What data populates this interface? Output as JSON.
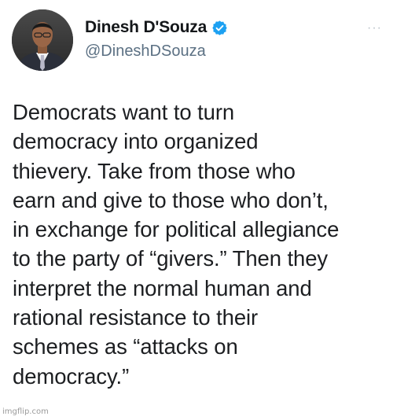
{
  "author": {
    "display_name": "Dinesh D'Souza",
    "handle": "@DineshDSouza",
    "verified": true,
    "verified_color": "#1da1f2"
  },
  "tweet": {
    "text": "Democrats want to turn\ndemocracy into organized\nthievery. Take from those who\nearn and give to those who don’t,\nin exchange for political allegiance\nto the party of “givers.” Then they\ninterpret the normal human and\nrational resistance to their\nschemes as “attacks on\ndemocracy.”"
  },
  "menu": {
    "icon": "more-horizontal-icon",
    "glyph": "···"
  },
  "watermark": {
    "text": "imgflip.com"
  }
}
